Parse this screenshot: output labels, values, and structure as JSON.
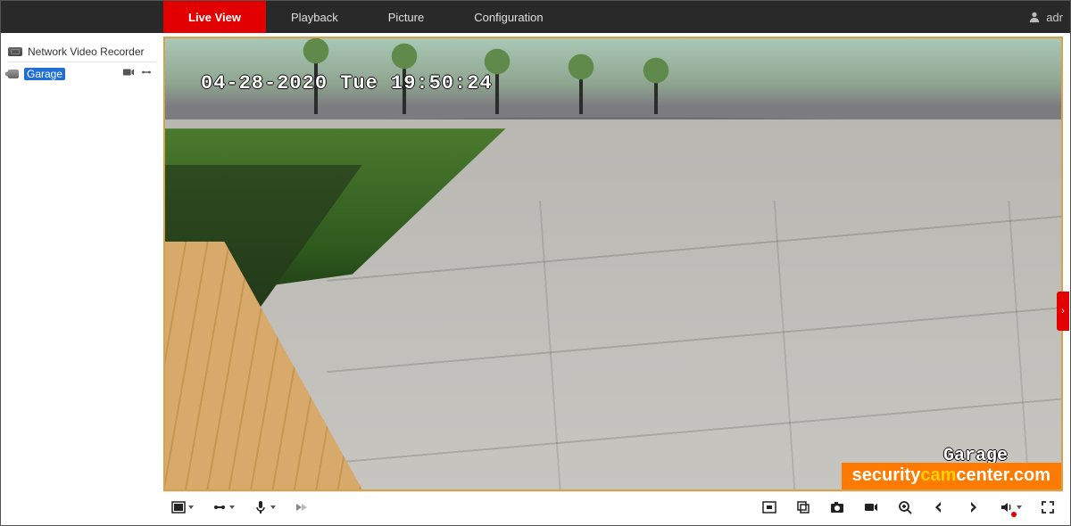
{
  "nav": {
    "tabs": [
      {
        "label": "Live View",
        "active": true
      },
      {
        "label": "Playback",
        "active": false
      },
      {
        "label": "Picture",
        "active": false
      },
      {
        "label": "Configuration",
        "active": false
      }
    ],
    "username": "adr"
  },
  "sidebar": {
    "device_label": "Network Video Recorder",
    "cameras": [
      {
        "name": "Garage",
        "selected": true
      }
    ]
  },
  "video": {
    "osd_timestamp": "04-28-2020 Tue 19:50:24",
    "osd_camera_name": "Garage"
  },
  "watermark": {
    "part1": "security",
    "part2": "cam",
    "part3": "center",
    "ext": ".com"
  },
  "toolbar_left": {
    "layout": "layout-single",
    "stream": "stream-toggle",
    "audio": "microphone",
    "ptz": "ptz-3d"
  },
  "toolbar_right": {
    "items": [
      "stop-all",
      "multiwindow",
      "snapshot",
      "record",
      "zoom",
      "prev",
      "next",
      "speaker",
      "fullscreen"
    ]
  },
  "colors": {
    "accent_red": "#e20000",
    "topbar_bg": "#292929",
    "watermark_bg": "#ff7a00",
    "watermark_highlight": "#ffd200",
    "selection_blue": "#1f6fd6",
    "frame_border": "#d6a24a"
  }
}
